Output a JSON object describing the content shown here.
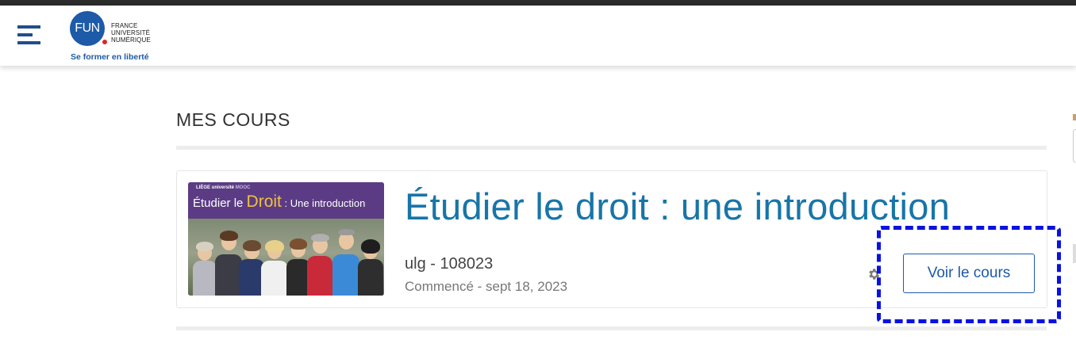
{
  "header": {
    "menu_icon": "hamburger-icon",
    "logo": {
      "mark": "FUN",
      "line1": "FRANCE",
      "line2": "UNIVERSITÉ",
      "line3": "NUMÉRIQUE",
      "tagline": "Se former en liberté"
    }
  },
  "main": {
    "title": "MES COURS",
    "courses": [
      {
        "thumbnail": {
          "brand_line1": "LIÈGE université",
          "brand_line2": "MOOC",
          "title_prefix": "Étudier le ",
          "title_big": "Droit",
          "title_suffix": " : Une introduction"
        },
        "title": "Étudier le droit : une introduction",
        "code": "ulg - 108023",
        "started": "Commencé - sept 18, 2023",
        "settings_icon": "gear-icon",
        "button_label": "Voir le cours"
      }
    ]
  },
  "colors": {
    "brand_blue": "#1d5aa8",
    "title_blue": "#1875a8",
    "highlight": "#0a12e0"
  }
}
